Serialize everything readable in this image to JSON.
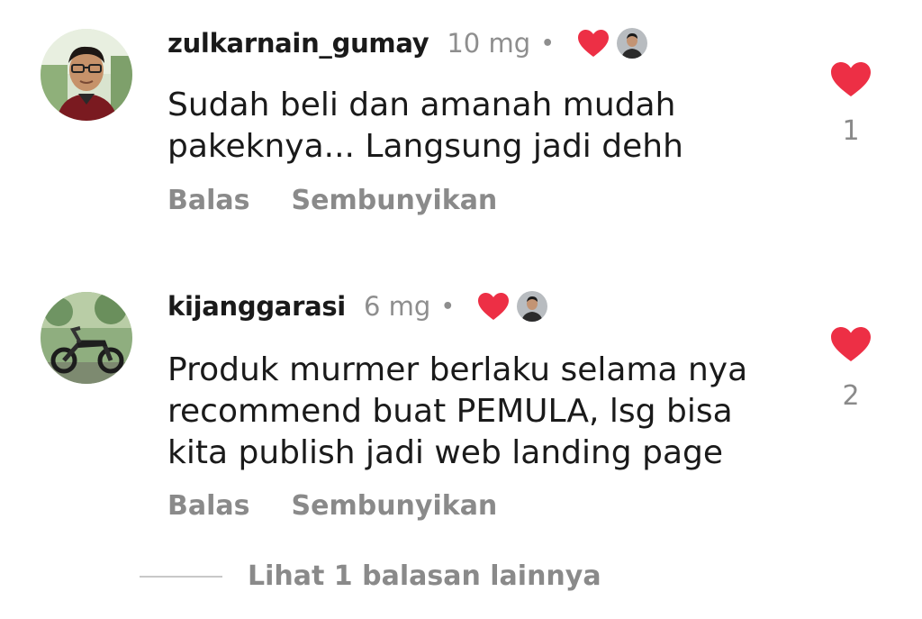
{
  "comments": [
    {
      "username": "zulkarnain_gumay",
      "time": "10 mg",
      "separator": "•",
      "text": "Sudah beli dan amanah mudah pakeknya... Langsung jadi dehh",
      "reply_label": "Balas",
      "hide_label": "Sembunyikan",
      "like_count": "1",
      "avatar_icon": "user-avatar-man-glasses",
      "liked_by_creator": true
    },
    {
      "username": "kijanggarasi",
      "time": "6 mg",
      "separator": "•",
      "text": "Produk murmer berlaku selama nya recommend buat PEMULA, lsg bisa kita publish jadi web landing page",
      "reply_label": "Balas",
      "hide_label": "Sembunyikan",
      "like_count": "2",
      "avatar_icon": "user-avatar-motorcycle",
      "liked_by_creator": true
    }
  ],
  "view_more_replies": "Lihat 1 balasan lainnya",
  "colors": {
    "heart": "#ed2f45",
    "muted_text": "#8a8a8a",
    "primary_text": "#1a1a1a"
  }
}
